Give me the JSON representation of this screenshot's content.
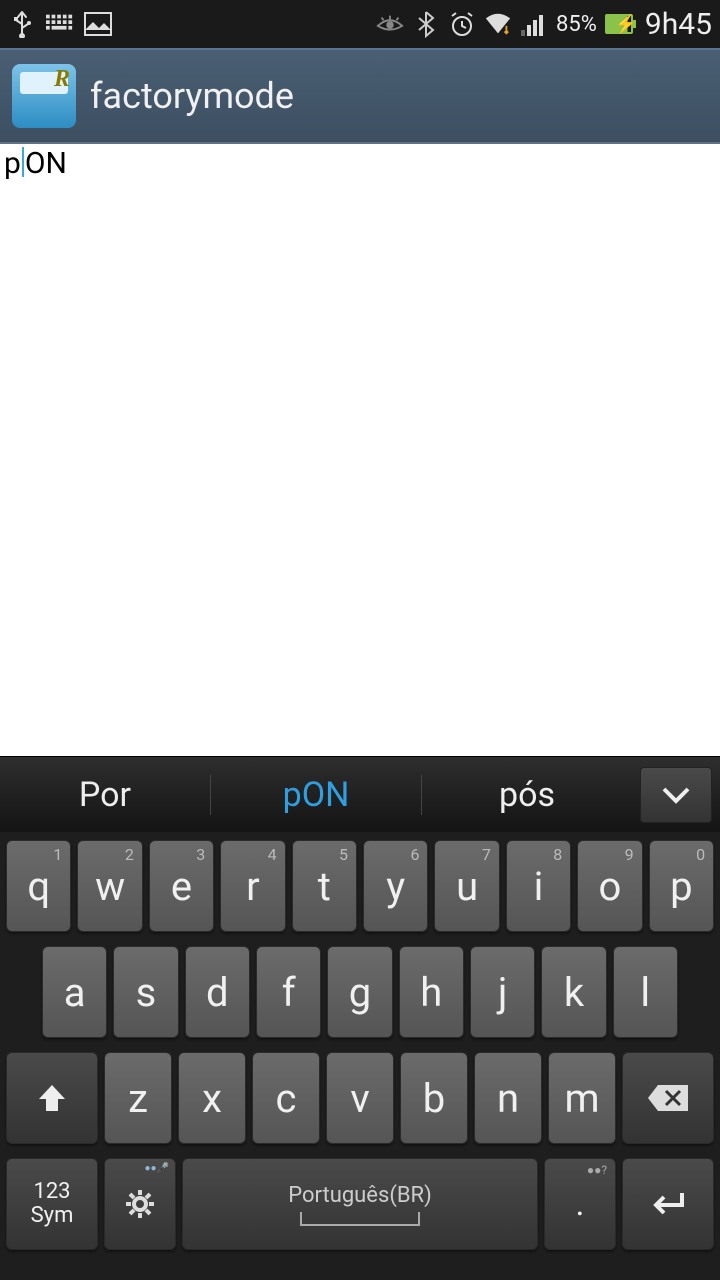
{
  "status": {
    "battery_pct": "85%",
    "time": "9h45"
  },
  "app": {
    "title": "factorymode"
  },
  "editor": {
    "text_before": "p",
    "text_after": "ON"
  },
  "suggestions": {
    "items": [
      "Por",
      "pON",
      "pós"
    ],
    "active_index": 1
  },
  "keyboard": {
    "language": "Português(BR)",
    "row1": [
      {
        "k": "q",
        "n": "1"
      },
      {
        "k": "w",
        "n": "2"
      },
      {
        "k": "e",
        "n": "3"
      },
      {
        "k": "r",
        "n": "4"
      },
      {
        "k": "t",
        "n": "5"
      },
      {
        "k": "y",
        "n": "6"
      },
      {
        "k": "u",
        "n": "7"
      },
      {
        "k": "i",
        "n": "8"
      },
      {
        "k": "o",
        "n": "9"
      },
      {
        "k": "p",
        "n": "0"
      }
    ],
    "row2": [
      "a",
      "s",
      "d",
      "f",
      "g",
      "h",
      "j",
      "k",
      "l"
    ],
    "row3": [
      "z",
      "x",
      "c",
      "v",
      "b",
      "n",
      "m"
    ],
    "sym_top": "123",
    "sym_bottom": "Sym",
    "period": "."
  }
}
